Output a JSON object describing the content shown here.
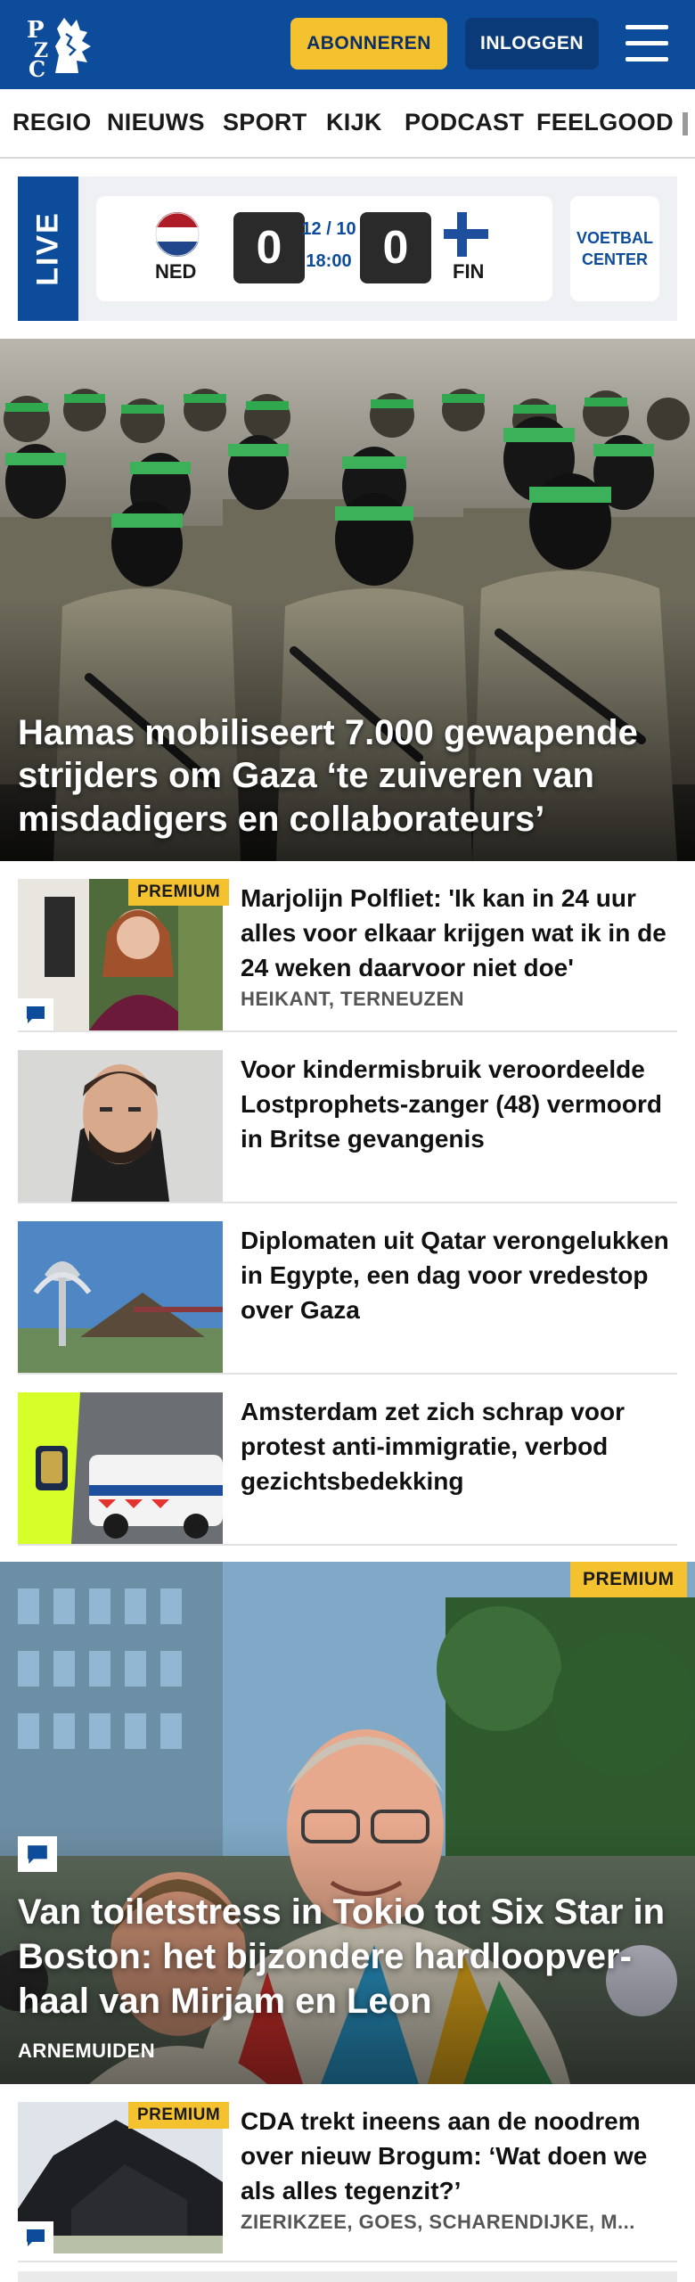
{
  "header": {
    "logo_text": "PZC",
    "subscribe_label": "ABONNEREN",
    "login_label": "INLOGGEN",
    "menu_icon": "hamburger-menu-icon",
    "brand_color": "#0d4c9a",
    "accent_color": "#f5c22f"
  },
  "nav": {
    "items": [
      {
        "label": "REGIO"
      },
      {
        "label": "NIEUWS"
      },
      {
        "label": "SPORT"
      },
      {
        "label": "KIJK"
      },
      {
        "label": "PODCAST"
      },
      {
        "label": "FEELGOOD"
      }
    ]
  },
  "live": {
    "tab_label": "LIVE",
    "home_team": "NED",
    "away_team": "FIN",
    "home_score": "0",
    "away_score": "0",
    "date": "12 / 10",
    "time": "18:00",
    "voetbal_center_line1": "VOETBAL",
    "voetbal_center_line2": "CENTER"
  },
  "hero": {
    "headline": "Hamas mobiliseert 7.000 gewapende strijders om Gaza ‘te zuiveren van misdadigers en collaborateurs’"
  },
  "articles": [
    {
      "title": "Marjolijn Polfliet: 'Ik kan in 24 uur alles voor elkaar krijgen wat ik in de 24 weken daarvoor niet doe'",
      "location": "HEIKANT, TERNEUZEN",
      "badge": "PREMIUM"
    },
    {
      "title": "Voor kindermisbruik veroordeel­de Lostprophets-zanger (48) vermoord in Britse gevangenis"
    },
    {
      "title": "Diplomaten uit Qatar verongelukken in Egypte, een dag voor vredestop over Gaza"
    },
    {
      "title": "Amsterdam zet zich schrap voor protest anti-immigratie, verbod gezichtsbedekking"
    }
  ],
  "feature": {
    "badge": "PREMIUM",
    "headline": "Van toiletstress in Tokio tot Six Star in Boston: het bijzondere hardloopver­haal van Mirjam en Leon",
    "location": "ARNEMUIDEN"
  },
  "bottom_article": {
    "badge": "PREMIUM",
    "title": "CDA trekt ineens aan de noodrem over nieuw Brogum: ‘Wat doen we als alles tegenzit?’",
    "location": "ZIERIKZEE, GOES, SCHARENDIJKE, M..."
  }
}
